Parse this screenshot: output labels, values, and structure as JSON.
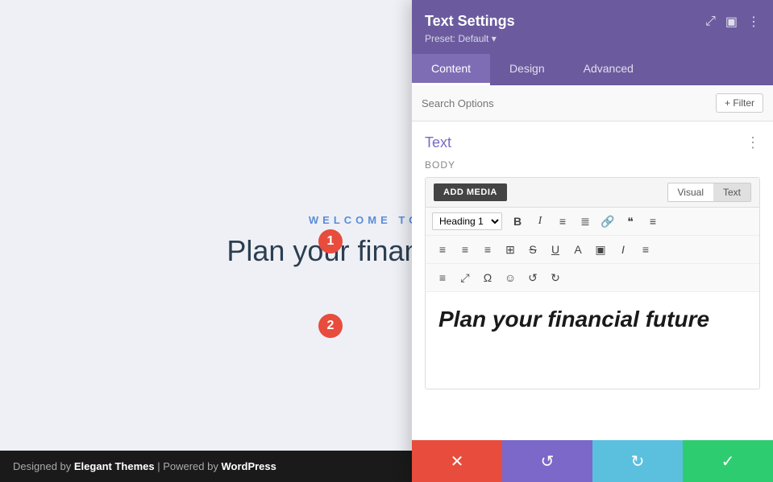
{
  "page": {
    "welcome": "WELCOME TO DIVI",
    "headline": "Plan your financial future",
    "footer_text": "Designed by ",
    "footer_brand1": "Elegant Themes",
    "footer_separator": " | Powered by ",
    "footer_brand2": "WordPress"
  },
  "panel": {
    "title": "Text Settings",
    "preset": "Preset: Default",
    "tabs": [
      {
        "label": "Content",
        "active": true
      },
      {
        "label": "Design",
        "active": false
      },
      {
        "label": "Advanced",
        "active": false
      }
    ],
    "search_placeholder": "Search Options",
    "filter_label": "+ Filter",
    "section_title": "Text",
    "body_label": "Body",
    "add_media_label": "ADD MEDIA",
    "view_visual": "Visual",
    "view_text": "Text",
    "heading_select": "Heading 1",
    "editor_content": "Plan your financial future",
    "footer": {
      "cancel": "✕",
      "undo": "↺",
      "redo": "↻",
      "save": "✓"
    }
  },
  "badges": {
    "one": "1",
    "two": "2"
  },
  "toolbar": {
    "row1": [
      "B",
      "I",
      "≡",
      "≣",
      "🔗",
      "❝",
      "≡"
    ],
    "row2": [
      "≡",
      "≡",
      "≡",
      "⊞",
      "S̶",
      "U̲",
      "A",
      "▣",
      "𝐼",
      "≡"
    ],
    "row3": [
      "≡",
      "⤢",
      "Ω",
      "☺",
      "↺",
      "↻"
    ]
  }
}
